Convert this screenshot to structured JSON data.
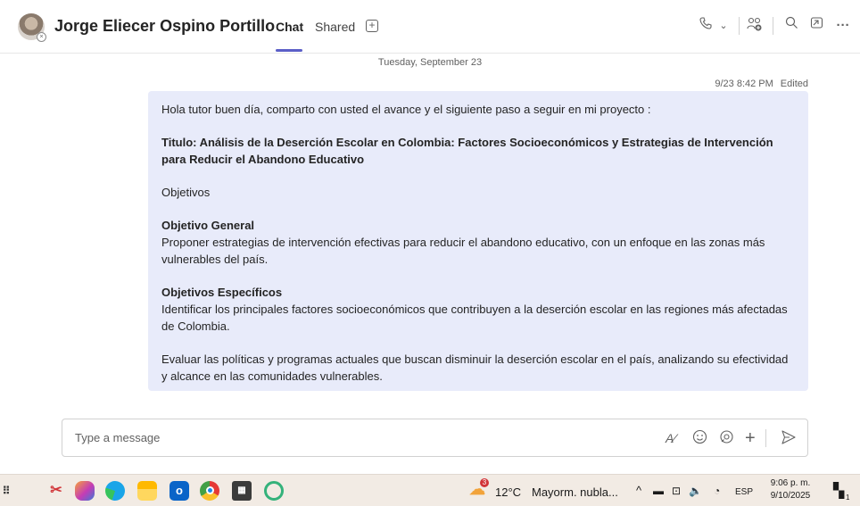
{
  "header": {
    "contact_name": "Jorge Eliecer Ospino Portillo",
    "tabs": [
      {
        "label": "Chat",
        "active": true
      },
      {
        "label": "Shared",
        "active": false
      }
    ],
    "icons": [
      "phone-icon",
      "chevron-down-icon",
      "add-people-icon",
      "search-icon",
      "popout-icon",
      "more-options-icon"
    ]
  },
  "chat": {
    "date_separator": "Tuesday, September 23",
    "message": {
      "timestamp": "9/23 8:42 PM",
      "edited_label": "Edited",
      "intro": "Hola tutor buen día, comparto con usted el avance y el siguiente paso a seguir en mi proyecto :",
      "title": "Titulo: Análisis de la Deserción Escolar en Colombia: Factores Socioeconómicos y Estrategias de Intervención para Reducir el Abandono Educativo",
      "objectives_label": "Objetivos",
      "general_heading": "Objetivo General",
      "general_text": "Proponer estrategias de intervención efectivas para reducir el abandono educativo, con un enfoque en las zonas más vulnerables del país.",
      "specific_heading": "Objetivos Específicos",
      "specific_text_1": "Identificar los principales factores socioeconómicos que contribuyen a la deserción escolar en las regiones más afectadas de Colombia.",
      "specific_text_2": "Evaluar las políticas y programas actuales que buscan disminuir la deserción escolar en el país, analizando su efectividad y alcance en las comunidades vulnerables."
    }
  },
  "compose": {
    "placeholder": "Type a message",
    "icons": [
      "format-icon",
      "emoji-icon",
      "loop-icon",
      "plus-icon",
      "send-icon"
    ]
  },
  "taskbar": {
    "weather_temp": "12°C",
    "weather_text": "Mayorm. nubla...",
    "weather_badge": "3",
    "language": "ESP",
    "time": "9:06 p. m.",
    "date": "9/10/2025",
    "notification_count": "1",
    "accent_colors": {
      "teams_purple": "#5b5fc7",
      "bubble_bg": "#e8ebfa"
    }
  }
}
